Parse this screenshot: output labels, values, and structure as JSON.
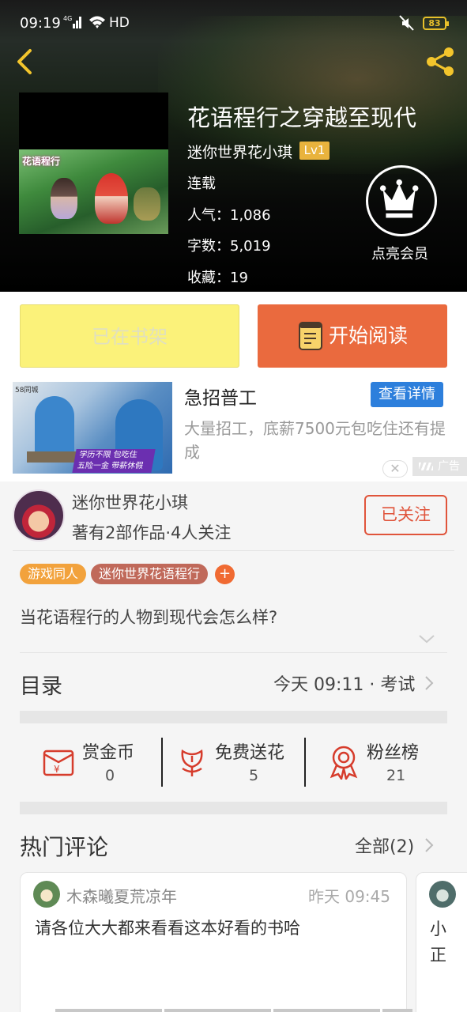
{
  "status_bar": {
    "time": "09:19",
    "network": "4G",
    "hd": "HD",
    "battery": "83"
  },
  "book": {
    "title": "花语程行之穿越至现代",
    "author": "迷你世界花小琪",
    "author_level": "Lv1",
    "status": "连载",
    "popularity": "人气：1,086",
    "word_count": "字数：5,019",
    "favorites": "收藏：19",
    "cover_logo": "花语程行"
  },
  "vip": {
    "label": "点亮会员"
  },
  "actions": {
    "shelf_label": "已在书架",
    "read_label": "开始阅读"
  },
  "ad": {
    "title": "急招普工",
    "button": "查看详情",
    "description": "大量招工，底薪7500元包吃住还有提成",
    "tag": "广告",
    "image_text_1": "学历不限 包吃住",
    "image_text_2": "五险一金 带薪休假",
    "image_corner": "58同城"
  },
  "writer": {
    "name": "迷你世界花小琪",
    "info": "著有2部作品·4人关注",
    "follow_label": "已关注"
  },
  "tags": [
    {
      "label": "游戏同人",
      "color": "#f2a23c"
    },
    {
      "label": "迷你世界花语程行",
      "color": "#c0695a"
    }
  ],
  "summary": "当花语程行的人物到现代会怎么样?",
  "catalog": {
    "title": "目录",
    "latest": "今天 09:11 · 考试"
  },
  "stats": [
    {
      "label": "赏金币",
      "value": "0",
      "icon": "red-envelope-icon"
    },
    {
      "label": "免费送花",
      "value": "5",
      "icon": "flower-icon"
    },
    {
      "label": "粉丝榜",
      "value": "21",
      "icon": "medal-icon"
    }
  ],
  "comments_section": {
    "title": "热门评论",
    "all_label": "全部(2)",
    "items": [
      {
        "user": "木森曦夏荒凉年",
        "time": "昨天 09:45",
        "text": "请各位大大都来看看这本好看的书哈"
      },
      {
        "text_line1": "小",
        "text_line2": "正"
      }
    ]
  },
  "colors": {
    "accent_orange": "#ea6a3e",
    "shelf_yellow": "#fbf27a",
    "follow_red": "#e0543b",
    "level_gold": "#e9b33d",
    "ad_blue": "#2d7fdc"
  }
}
